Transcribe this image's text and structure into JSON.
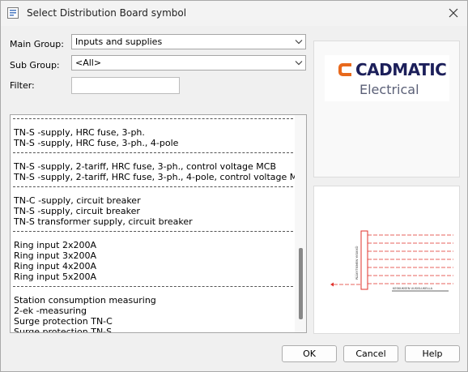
{
  "window": {
    "title": "Select Distribution Board symbol"
  },
  "form": {
    "main_group_label": "Main Group:",
    "main_group_value": "Inputs and supplies",
    "sub_group_label": "Sub Group:",
    "sub_group_value": "<All>",
    "filter_label": "Filter:",
    "filter_value": ""
  },
  "list": {
    "groups": [
      [
        "TN-S -supply, HRC fuse, 3-ph.",
        "TN-S -supply, HRC fuse, 3-ph., 4-pole"
      ],
      [
        "TN-S -supply, 2-tariff, HRC fuse, 3-ph., control voltage MCB",
        "TN-S -supply, 2-tariff, HRC fuse, 3-ph., 4-pole, control voltage MCB"
      ],
      [
        "TN-C -supply, circuit breaker",
        "TN-S -supply, circuit breaker",
        "TN-S transformer supply, circuit breaker"
      ],
      [
        "Ring input 2x200A",
        "Ring input 3x200A",
        "Ring input 4x200A",
        "Ring input 5x200A"
      ],
      [
        "Station consumption measuring",
        "2-ek -measuring",
        "Surge protection TN-C",
        "Surge protection TN-S"
      ]
    ]
  },
  "logo": {
    "brand": "CADMATIC",
    "product": "Electrical",
    "brand_color": "#1c1f5a",
    "accent_color": "#e8691c"
  },
  "preview": {
    "vertical_label": "PÄÄKYTKIMEN YKSIKKÖ",
    "bottom_label": "KESKUKSEN UUSISLUKELLA",
    "line_color": "#e0302a"
  },
  "buttons": {
    "ok": "OK",
    "cancel": "Cancel",
    "help": "Help"
  },
  "icons": {
    "app": "app-icon",
    "close": "close-icon",
    "dropdown": "chevron-down-icon"
  }
}
